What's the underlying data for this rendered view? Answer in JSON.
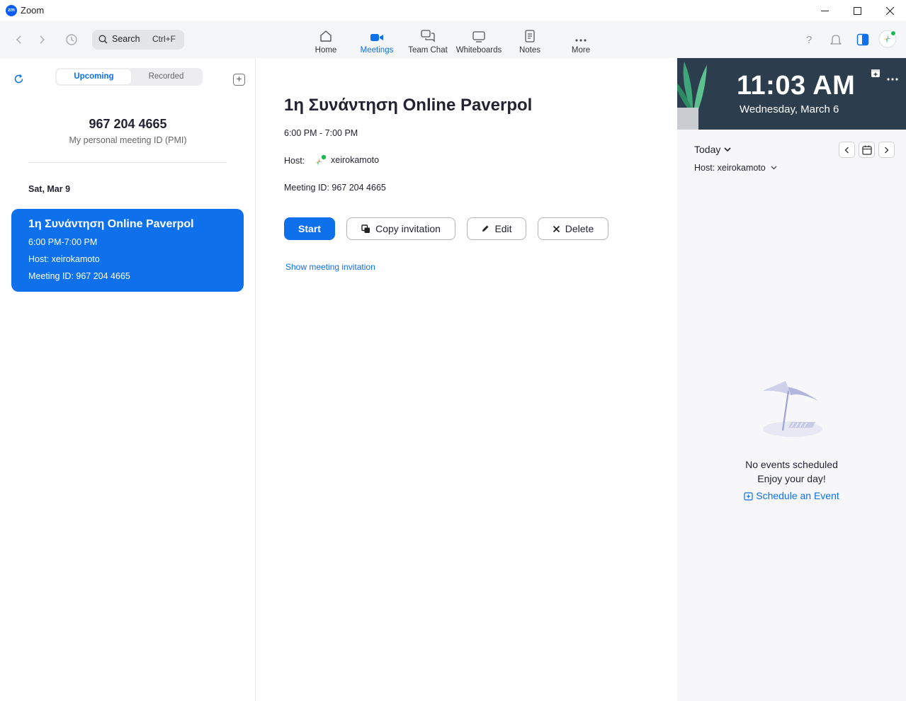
{
  "window": {
    "logo_text": "zm",
    "title": "Zoom"
  },
  "toolbar": {
    "search_label": "Search",
    "search_shortcut": "Ctrl+F",
    "tabs": [
      {
        "label": "Home",
        "icon": "home-icon"
      },
      {
        "label": "Meetings",
        "icon": "video-camera-icon",
        "active": true
      },
      {
        "label": "Team Chat",
        "icon": "chat-bubbles-icon"
      },
      {
        "label": "Whiteboards",
        "icon": "whiteboard-icon"
      },
      {
        "label": "Notes",
        "icon": "notes-icon"
      },
      {
        "label": "More",
        "icon": "more-dots-icon"
      }
    ]
  },
  "left": {
    "tabs": {
      "upcoming": "Upcoming",
      "recorded": "Recorded"
    },
    "pmi_number": "967 204 4665",
    "pmi_label": "My personal meeting ID (PMI)",
    "date_heading": "Sat, Mar 9",
    "card": {
      "title": "1η Συνάντηση Online Paverpol",
      "time": "6:00 PM-7:00 PM",
      "host": "Host: xeirokamoto",
      "meeting_id": "Meeting ID: 967 204 4665"
    }
  },
  "detail": {
    "title": "1η Συνάντηση Online Paverpol",
    "time": "6:00 PM - 7:00 PM",
    "host_label": "Host:",
    "host_name": "xeirokamoto",
    "meeting_id": "Meeting ID: 967 204 4665",
    "buttons": {
      "start": "Start",
      "copy": "Copy invitation",
      "edit": "Edit",
      "delete": "Delete"
    },
    "show_invitation": "Show meeting invitation"
  },
  "calendar": {
    "time": "11:03 AM",
    "date": "Wednesday, March 6",
    "today_label": "Today",
    "host_filter": "Host: xeirokamoto",
    "empty_line1": "No events scheduled",
    "empty_line2": "Enjoy your day!",
    "schedule_link": "Schedule an Event"
  },
  "colors": {
    "accent": "#0e71eb",
    "banner": "#2c3e4d",
    "presence": "#1db954"
  }
}
